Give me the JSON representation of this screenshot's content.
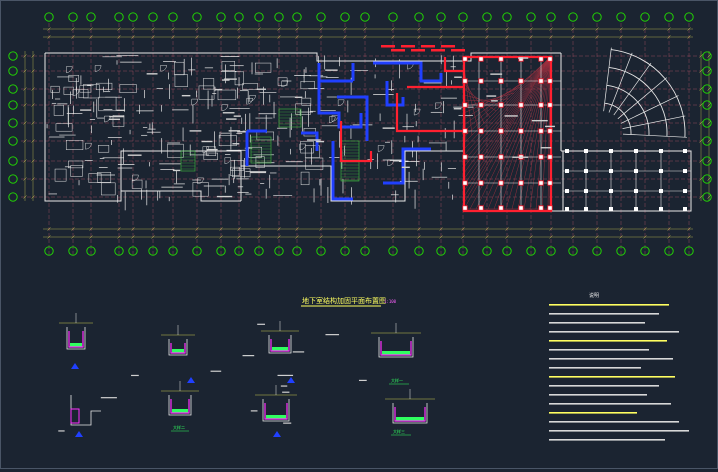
{
  "drawing": {
    "title": "地下室结构加固平面布置图",
    "title_scale": "1:100",
    "notes_heading": "说明",
    "detail_labels": [
      "大样一",
      "大样二",
      "大样三"
    ]
  },
  "colors": {
    "background": "#1b2431",
    "grid_axis": "#c75a6e",
    "axis_bubble": "#22e000",
    "walls": "#e8e8e8",
    "reinforce_blue": "#2040ff",
    "reinforce_red": "#ff2030",
    "hatch": "#a03040",
    "dimension": "#c8c850",
    "detail_green": "#30ff60",
    "detail_magenta": "#ff30ff",
    "text_yellow": "#ffff60",
    "stair_green": "#40c040"
  }
}
